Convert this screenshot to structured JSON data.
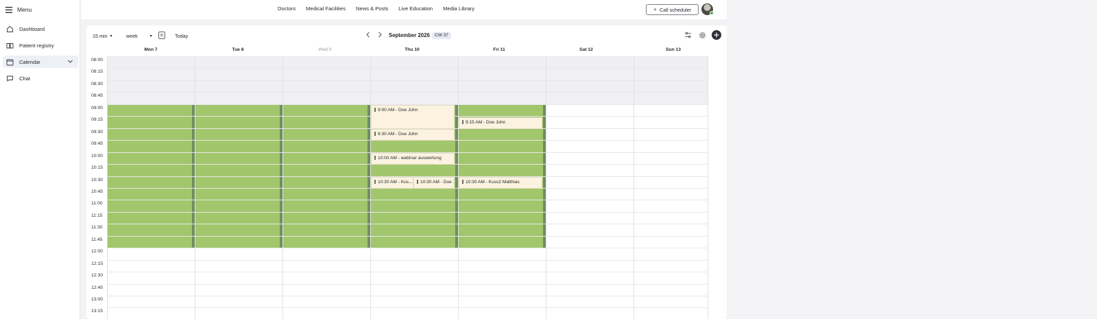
{
  "sidebar": {
    "menu_label": "Menu",
    "items": [
      {
        "label": "Dashboard",
        "icon": "home-icon"
      },
      {
        "label": "Patient registry",
        "icon": "book-icon"
      },
      {
        "label": "Calendar",
        "icon": "calendar-icon"
      },
      {
        "label": "Chat",
        "icon": "chat-icon"
      }
    ]
  },
  "topnav": {
    "links": [
      "Doctors",
      "Medical Facilities",
      "News & Posts",
      "Live Education",
      "Media Library"
    ],
    "call_scheduler": "Call scheduler"
  },
  "toolbar": {
    "interval": "15 min",
    "view": "week",
    "today": "Today",
    "calendar_badge_icon": "31",
    "month": "September 2026",
    "cw": "CW 37"
  },
  "days": [
    "Mon 7",
    "Tue 8",
    "Wed 9",
    "Thu 10",
    "Fri 11",
    "Sat 12",
    "Sun 13"
  ],
  "times": [
    "08:00",
    "08:15",
    "08:30",
    "08:45",
    "09:00",
    "09:15",
    "09:30",
    "09:45",
    "10:00",
    "10:15",
    "10:30",
    "10:45",
    "11:00",
    "11:15",
    "11:30",
    "11:45",
    "12:00",
    "12:15",
    "12:30",
    "12:45",
    "13:00",
    "13:15"
  ],
  "events": [
    {
      "label": "9:00 AM - Doe John"
    },
    {
      "label": "9:30 AM - Doe John"
    },
    {
      "label": "10:00 AM - webinar auswertung"
    },
    {
      "label": "10:30 AM - Kus..."
    },
    {
      "label": "10:30 AM - Doe ..."
    },
    {
      "label": "9:15 AM - Doe John"
    },
    {
      "label": "10:30 AM - Kuss2 Matthias"
    }
  ],
  "colors": {
    "available": "#a1c66b",
    "event_bg": "#fbf3df",
    "accent_dark": "#2f3136",
    "status_online": "#4caf50"
  }
}
